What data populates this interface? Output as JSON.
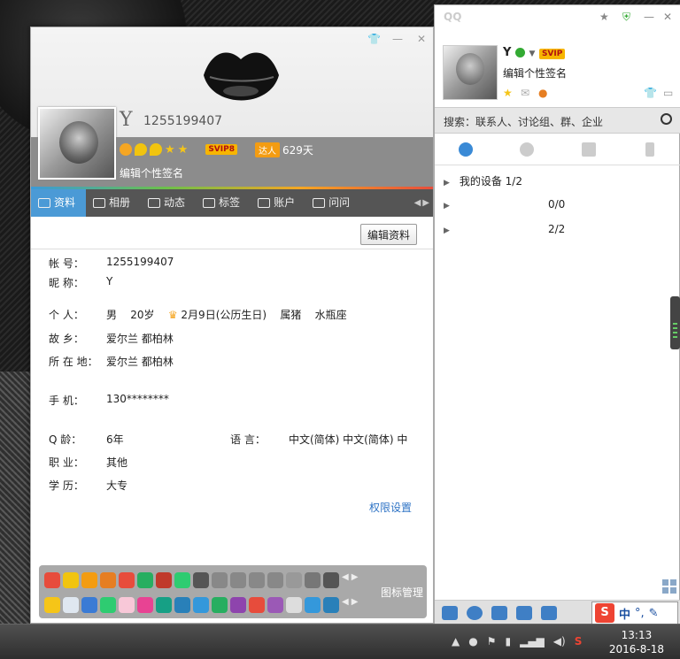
{
  "profile": {
    "nickname": "Y",
    "qq_number": "1255199407",
    "signature": "编辑个性签名",
    "vip_label": "SVIP8",
    "daren_label": "达人",
    "days": "629天",
    "tabs": [
      "资料",
      "相册",
      "动态",
      "标签",
      "账户",
      "问问"
    ],
    "edit_button": "编辑资料",
    "fields": {
      "account": {
        "label": "帐      号：",
        "value": "1255199407"
      },
      "nick": {
        "label": "昵      称：",
        "value": "Y"
      },
      "personal": {
        "label": "个      人：",
        "gender": "男",
        "age": "20岁",
        "birthday": "2月9日(公历生日)",
        "zodiac": "属猪",
        "constellation": "水瓶座"
      },
      "hometown": {
        "label": "故      乡：",
        "value": "爱尔兰 都柏林"
      },
      "location": {
        "label": "所 在 地：",
        "value": "爱尔兰 都柏林"
      },
      "phone": {
        "label": "手      机：",
        "value": "130********"
      },
      "qage": {
        "label": "Q      龄：",
        "value": "6年"
      },
      "language": {
        "label": "语      言：",
        "value": "中文(简体)  中文(简体)  中"
      },
      "job": {
        "label": "职      业：",
        "value": "其他"
      },
      "edu": {
        "label": "学      历：",
        "value": "大专"
      }
    },
    "permission_link": "权限设置",
    "icon_manage": "图标管理"
  },
  "main": {
    "logo": "QQ",
    "name": "Y",
    "level_badge": "SVIP",
    "signature": "编辑个性签名",
    "search_placeholder": "搜索：联系人、讨论组、群、企业",
    "groups": [
      {
        "name": "我的设备",
        "count": "1/2"
      },
      {
        "name": "",
        "count": "0/0"
      },
      {
        "name": "",
        "count": "2/2"
      }
    ]
  },
  "ime": {
    "logo": "S",
    "mode": "中",
    "punct": "°,"
  },
  "taskbar": {
    "time": "13:13",
    "date": "2016-8-18"
  },
  "colors": {
    "tab_active": "#4b9ad6",
    "link": "#2e73c5",
    "band": "#8c8c8c"
  }
}
